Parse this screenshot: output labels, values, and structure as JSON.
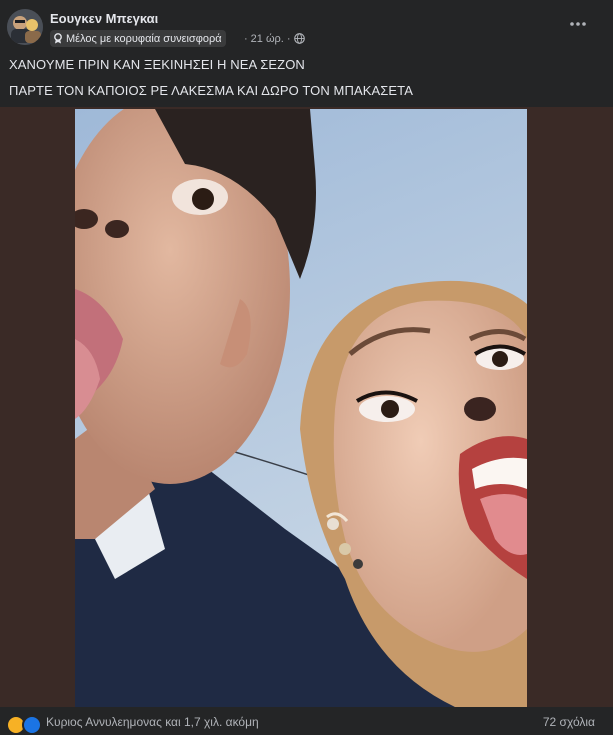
{
  "post": {
    "author": "Εουγκεν Μπεγκαι",
    "badge_label": "Μέλος με κορυφαία συνεισφορά",
    "timestamp": "21 ώρ.",
    "separator": "·",
    "lines": [
      "ΧΑΝΟΥΜΕ ΠΡΙΝ ΚΑΝ ΞΕΚΙΝΗΣΕΙ Η ΝΕΑ ΣΕΖΟΝ",
      "ΠΑΡΤΕ ΤΟΝ ΚΑΠΟΙΟΣ ΡΕ ΛΑΚΕΣΜΑ ΚΑΙ ΔΩΡΟ ΤΟΝ ΜΠΑΚΑΣΕΤΑ"
    ]
  },
  "footer": {
    "reactions_text": "Κυριος Αννυλεημονας και 1,7 χιλ. ακόμη",
    "comments_text": "72 σχόλια"
  },
  "icons": {
    "badge": "badge-icon",
    "audience": "globe-icon",
    "more": "more-options-icon"
  },
  "colors": {
    "background": "#242526",
    "text": "#e4e6eb",
    "muted": "#b0b3b8",
    "media_bg": "#3a2a26",
    "sky": "#b7cce0"
  }
}
